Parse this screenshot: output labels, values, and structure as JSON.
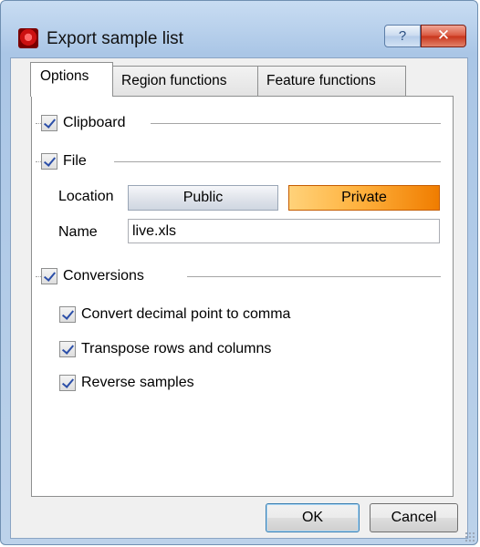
{
  "window": {
    "title": "Export sample list"
  },
  "titlebar": {
    "help_label": "?",
    "close_label": "✕"
  },
  "tabs": [
    {
      "label": "Options"
    },
    {
      "label": "Region functions"
    },
    {
      "label": "Feature functions"
    }
  ],
  "options": {
    "clipboard": {
      "label": "Clipboard",
      "checked": true
    },
    "file": {
      "label": "File",
      "checked": true
    },
    "location": {
      "label": "Location",
      "options": [
        "Public",
        "Private"
      ],
      "selected": "Private"
    },
    "name": {
      "label": "Name",
      "value": "live.xls"
    },
    "conversions": {
      "label": "Conversions",
      "checked": true
    },
    "items": [
      {
        "label": "Convert decimal point to comma",
        "checked": true
      },
      {
        "label": "Transpose rows and columns",
        "checked": true
      },
      {
        "label": "Reverse samples",
        "checked": true
      }
    ]
  },
  "buttons": {
    "ok": "OK",
    "cancel": "Cancel"
  },
  "colors": {
    "accent_private": "#ff9d2a",
    "check": "#2b4ea8",
    "title_bar": "#b9d1ec"
  }
}
